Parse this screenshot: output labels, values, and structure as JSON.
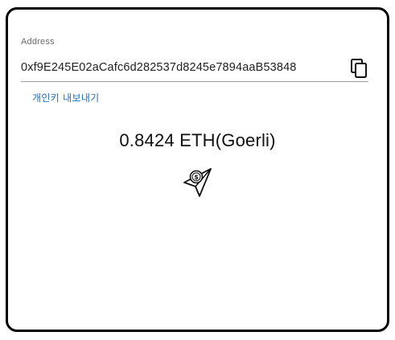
{
  "wallet": {
    "address_label": "Address",
    "address": "0xf9E245E02aCafc6d282537d8245e7894aaB53848",
    "export_private_key_label": "개인키 내보내기",
    "balance": "0.8424 ETH(Goerli)",
    "icons": {
      "copy": "copy-icon",
      "send": "send-coin-plane-icon"
    }
  }
}
